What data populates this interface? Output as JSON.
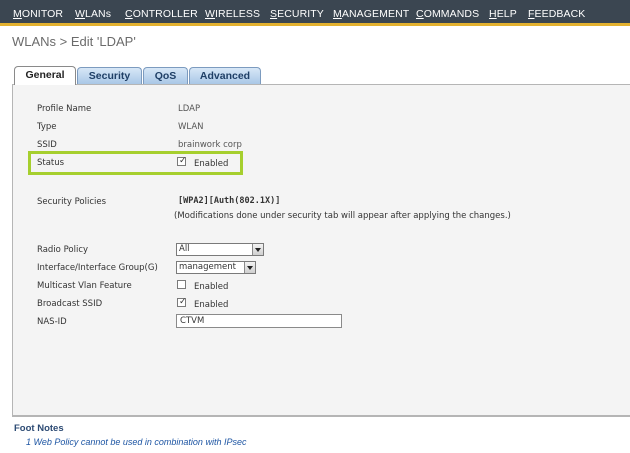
{
  "nav": {
    "items": [
      {
        "label": "MONITOR",
        "underline": "M",
        "rest": "ONITOR"
      },
      {
        "label": "WLANs",
        "underline": "W",
        "rest": "LANs"
      },
      {
        "label": "CONTROLLER",
        "underline": "C",
        "rest": "ONTROLLER"
      },
      {
        "label": "WIRELESS",
        "underline": "W",
        "rest": "IRELESS"
      },
      {
        "label": "SECURITY",
        "underline": "S",
        "rest": "ECURITY"
      },
      {
        "label": "MANAGEMENT",
        "underline": "M",
        "rest": "ANAGEMENT"
      },
      {
        "label": "COMMANDS",
        "underline": "C",
        "rest": "OMMANDS"
      },
      {
        "label": "HELP",
        "underline": "H",
        "rest": "ELP"
      },
      {
        "label": "FEEDBACK",
        "underline": "F",
        "rest": "EEDBACK"
      }
    ]
  },
  "page": {
    "title": "WLANs > Edit  'LDAP'"
  },
  "tabs": [
    "General",
    "Security",
    "QoS",
    "Advanced"
  ],
  "general": {
    "profile_name_label": "Profile Name",
    "profile_name_value": "LDAP",
    "type_label": "Type",
    "type_value": "WLAN",
    "ssid_label": "SSID",
    "ssid_value": "brainwork corp",
    "status_label": "Status",
    "status_checked": true,
    "status_text": "Enabled",
    "security_policies_label": "Security Policies",
    "security_policies_value": "[WPA2][Auth(802.1X)]",
    "security_note": "(Modifications done under security tab will appear after applying the changes.)",
    "radio_policy_label": "Radio Policy",
    "radio_policy_value": "All",
    "interface_label": "Interface/Interface Group(G)",
    "interface_value": "management",
    "multicast_label": "Multicast Vlan Feature",
    "multicast_checked": false,
    "multicast_text": "Enabled",
    "broadcast_label": "Broadcast SSID",
    "broadcast_checked": true,
    "broadcast_text": "Enabled",
    "nasid_label": "NAS-ID",
    "nasid_value": "CTVM"
  },
  "footnotes": {
    "title": "Foot Notes",
    "lines": [
      "1 Web Policy cannot be used in combination with IPsec"
    ]
  },
  "colors": {
    "nav_bg": "#3b4651",
    "nav_accent": "#e3b12f",
    "highlight": "#a6cf2e",
    "tab_blue": "#a9c7e6"
  }
}
